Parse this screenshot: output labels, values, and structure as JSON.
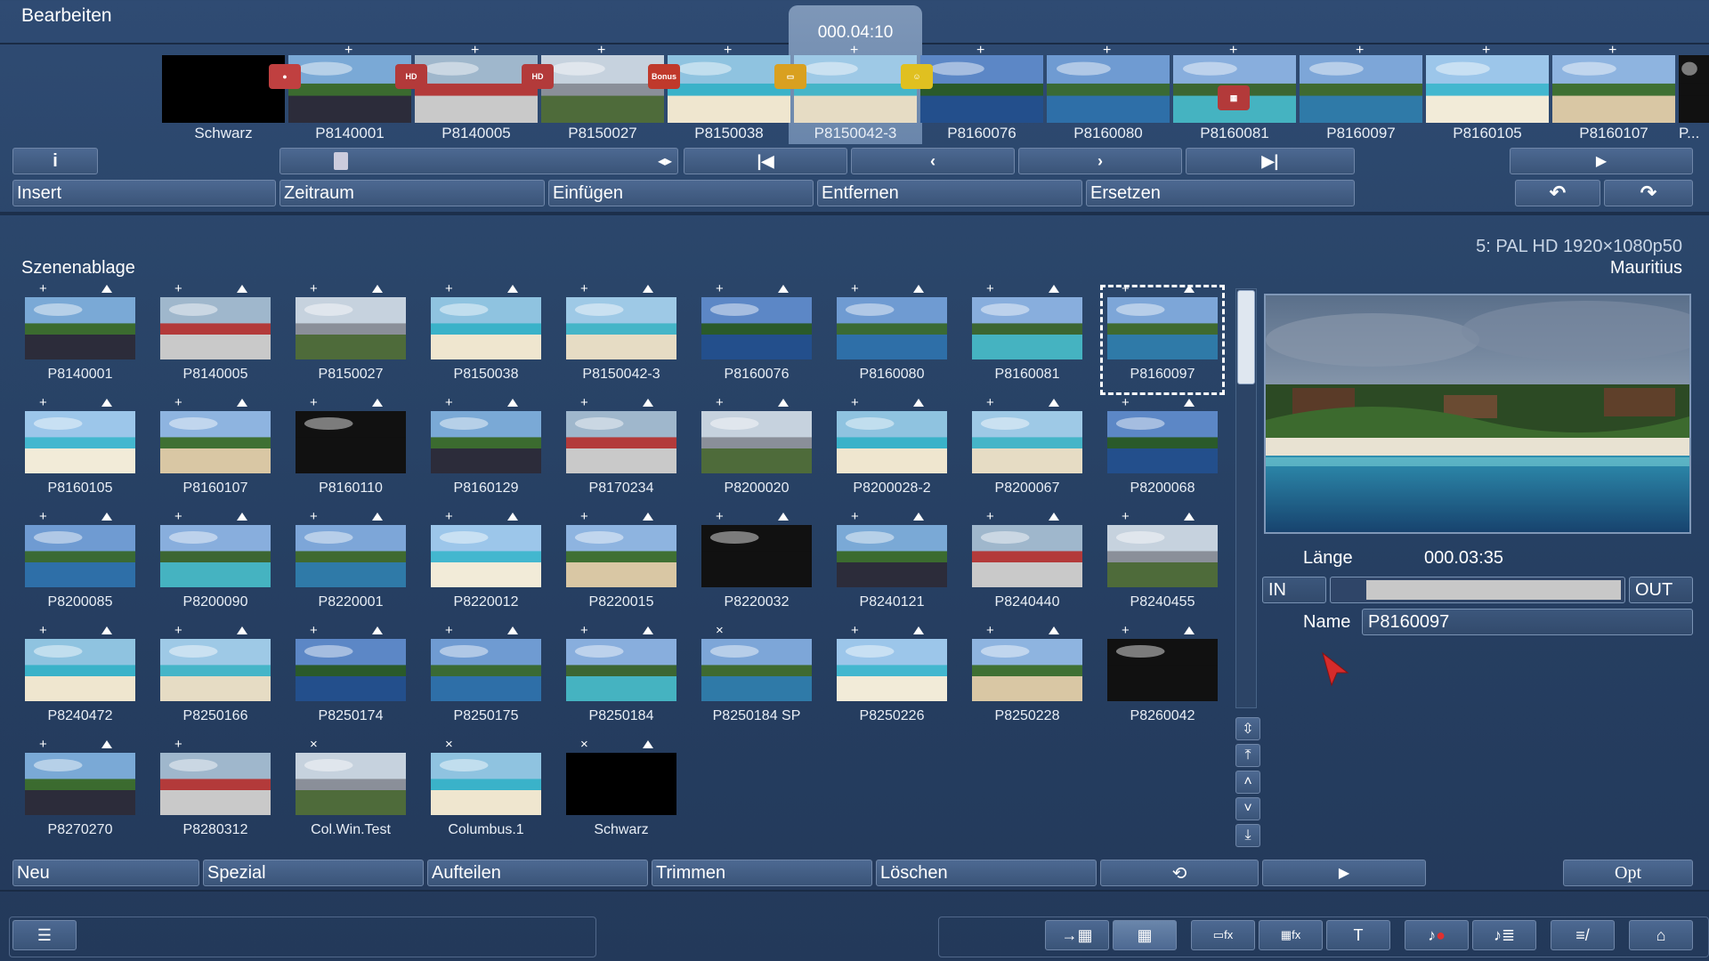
{
  "header": {
    "title": "Bearbeiten"
  },
  "timeline": {
    "current_time": "000.04:10",
    "items": [
      {
        "label": "Schwarz"
      },
      {
        "label": "P8140001"
      },
      {
        "label": "P8140005"
      },
      {
        "label": "P8150027"
      },
      {
        "label": "P8150038"
      },
      {
        "label": "P8150042-3"
      },
      {
        "label": "P8160076"
      },
      {
        "label": "P8160080"
      },
      {
        "label": "P8160081"
      },
      {
        "label": "P8160097"
      },
      {
        "label": "P8160105"
      },
      {
        "label": "P8160107"
      },
      {
        "label": "P..."
      }
    ],
    "badges": {
      "hd": "HD",
      "bonus": "Bonus"
    }
  },
  "controls": {
    "info": "i",
    "first": "K",
    "prev": "<",
    "next": ">",
    "last": "K",
    "play": "▶",
    "undo": "↶",
    "redo": "↷"
  },
  "edit_buttons": {
    "insert": "Insert",
    "zeitraum": "Zeitraum",
    "einfuegen": "Einfügen",
    "entfernen": "Entfernen",
    "ersetzen": "Ersetzen"
  },
  "project": {
    "format": "5: PAL HD 1920×1080p50",
    "name": "Mauritius"
  },
  "bin": {
    "title": "Szenenablage",
    "scenes": [
      {
        "label": "P8140001"
      },
      {
        "label": "P8140005"
      },
      {
        "label": "P8150027"
      },
      {
        "label": "P8150038"
      },
      {
        "label": "P8150042-3"
      },
      {
        "label": "P8160076"
      },
      {
        "label": "P8160080"
      },
      {
        "label": "P8160081"
      },
      {
        "label": "P8160097"
      },
      {
        "label": "P8160105"
      },
      {
        "label": "P8160107"
      },
      {
        "label": "P8160110"
      },
      {
        "label": "P8160129"
      },
      {
        "label": "P8170234"
      },
      {
        "label": "P8200020"
      },
      {
        "label": "P8200028-2"
      },
      {
        "label": "P8200067"
      },
      {
        "label": "P8200068"
      },
      {
        "label": "P8200085"
      },
      {
        "label": "P8200090"
      },
      {
        "label": "P8220001"
      },
      {
        "label": "P8220012"
      },
      {
        "label": "P8220015"
      },
      {
        "label": "P8220032"
      },
      {
        "label": "P8240121"
      },
      {
        "label": "P8240440"
      },
      {
        "label": "P8240455"
      },
      {
        "label": "P8240472"
      },
      {
        "label": "P8250166"
      },
      {
        "label": "P8250174"
      },
      {
        "label": "P8250175"
      },
      {
        "label": "P8250184"
      },
      {
        "label": "P8250184 SP"
      },
      {
        "label": "P8250226"
      },
      {
        "label": "P8250228"
      },
      {
        "label": "P8260042"
      },
      {
        "label": "P8270270"
      },
      {
        "label": "P8280312"
      },
      {
        "label": "Col.Win.Test"
      },
      {
        "label": "Columbus.1"
      },
      {
        "label": "Schwarz"
      }
    ],
    "selected": "P8160097"
  },
  "detail": {
    "laenge_label": "Länge",
    "laenge_value": "000.03:35",
    "in_label": "IN",
    "out_label": "OUT",
    "name_label": "Name",
    "name_value": "P8160097"
  },
  "bottom_buttons": {
    "neu": "Neu",
    "spezial": "Spezial",
    "aufteilen": "Aufteilen",
    "trimmen": "Trimmen",
    "loeschen": "Löschen",
    "opt": "Opt"
  }
}
